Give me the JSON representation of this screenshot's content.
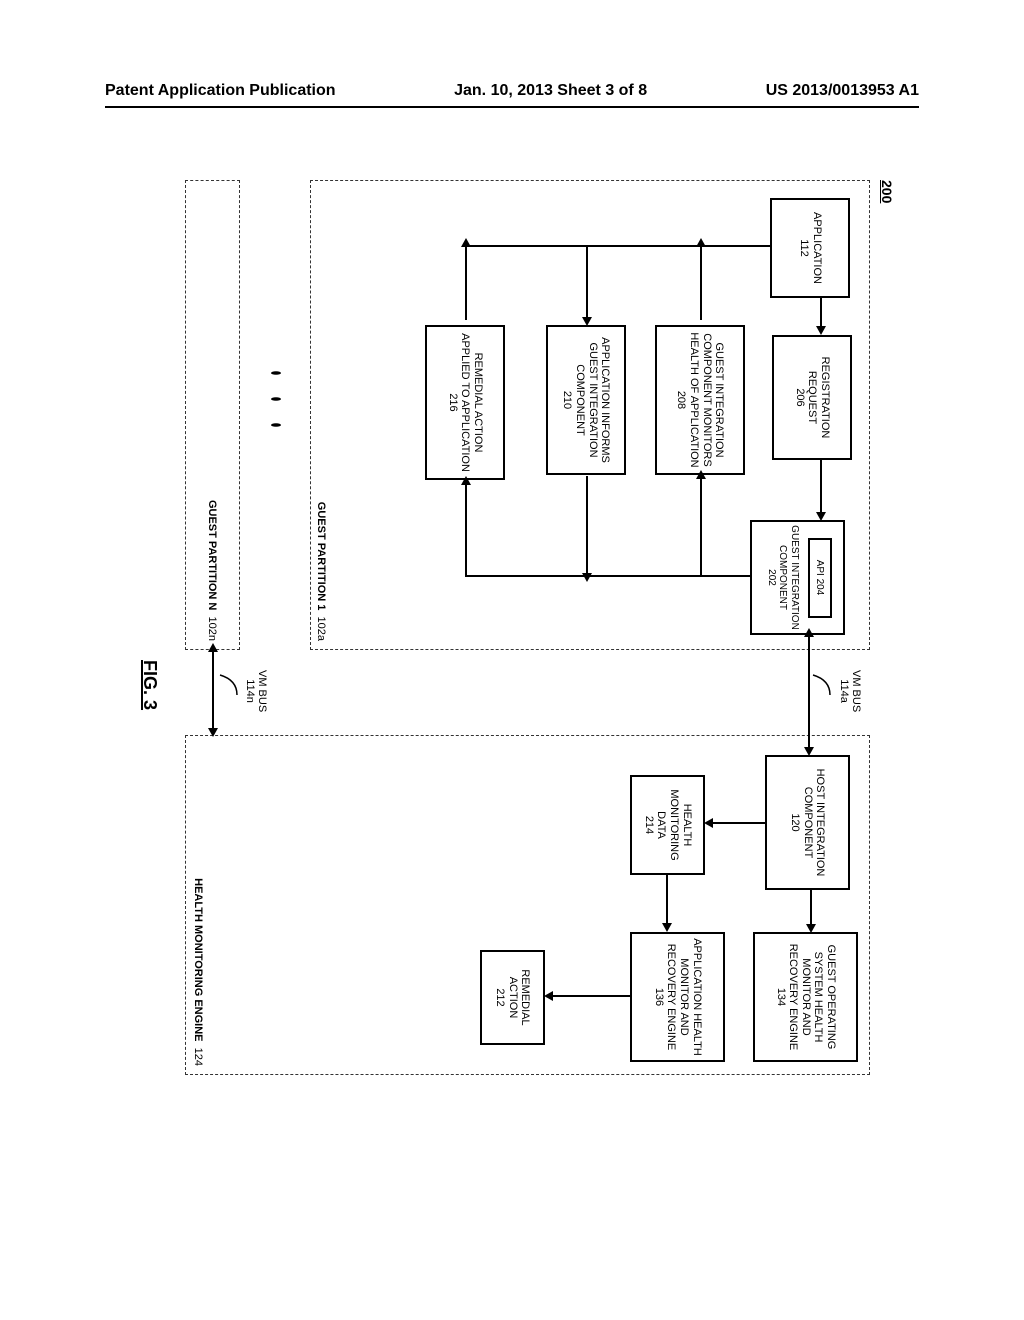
{
  "header": {
    "left": "Patent Application Publication",
    "center": "Jan. 10, 2013  Sheet 3 of 8",
    "right": "US 2013/0013953 A1"
  },
  "figure": {
    "ref": "200",
    "caption": "FIG. 3",
    "guest_partition_1": {
      "label": "GUEST PARTITION 1",
      "id": "102a",
      "application": {
        "label": "APPLICATION",
        "id": "112"
      },
      "registration_request": {
        "label": "REGISTRATION REQUEST",
        "id": "206"
      },
      "gic_monitors": {
        "label": "GUEST INTEGRATION COMPONENT MONITORS HEALTH OF APPLICATION",
        "id": "208"
      },
      "app_informs": {
        "label": "APPLICATION INFORMS GUEST INTEGRATION COMPONENT",
        "id": "210"
      },
      "remedial_applied": {
        "label": "REMEDIAL ACTION APPLIED TO APPLICATION",
        "id": "216"
      },
      "guest_integration": {
        "label": "GUEST INTEGRATION COMPONENT",
        "id": "202"
      },
      "api": {
        "label": "API",
        "id": "204"
      }
    },
    "guest_partition_n": {
      "label": "GUEST PARTITION N",
      "id": "102n"
    },
    "vmbus_a": {
      "label": "VM BUS",
      "id": "114a"
    },
    "vmbus_n": {
      "label": "VM BUS",
      "id": "114n"
    },
    "health_engine": {
      "label": "HEALTH MONITORING ENGINE",
      "id": "124",
      "host_integration": {
        "label": "HOST INTEGRATION COMPONENT",
        "id": "120"
      },
      "health_data": {
        "label": "HEALTH MONITORING DATA",
        "id": "214"
      },
      "guest_os_monitor": {
        "label": "GUEST OPERATING SYSTEM HEALTH MONITOR AND RECOVERY ENGINE",
        "id": "134"
      },
      "app_health_monitor": {
        "label": "APPLICATION HEALTH MONITOR AND RECOVERY ENGINE",
        "id": "136"
      },
      "remedial_action": {
        "label": "REMEDIAL ACTION",
        "id": "212"
      }
    }
  }
}
